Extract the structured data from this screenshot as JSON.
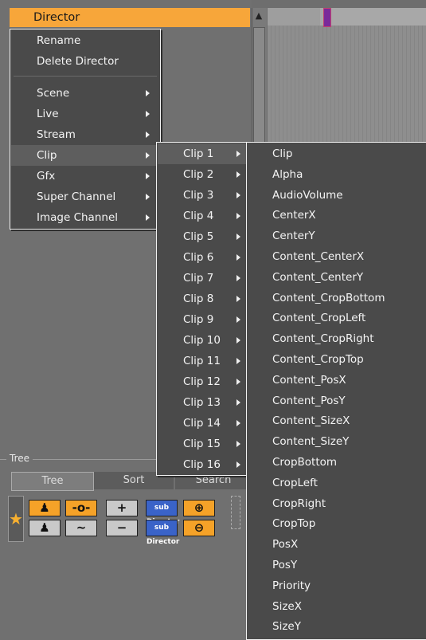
{
  "tree": {
    "root_item": "Director",
    "section_label": "Tree",
    "tabs": [
      "Tree",
      "Sort",
      "Search"
    ]
  },
  "context_menu": {
    "items": [
      {
        "label": "Rename",
        "submenu": false
      },
      {
        "label": "Delete Director",
        "submenu": false
      },
      {
        "label": "Scene",
        "submenu": true
      },
      {
        "label": "Live",
        "submenu": true
      },
      {
        "label": "Stream",
        "submenu": true
      },
      {
        "label": "Clip",
        "submenu": true,
        "selected": true
      },
      {
        "label": "Gfx",
        "submenu": true
      },
      {
        "label": "Super Channel",
        "submenu": true
      },
      {
        "label": "Image Channel",
        "submenu": true
      }
    ]
  },
  "clip_menu": {
    "items": [
      "Clip 1",
      "Clip 2",
      "Clip 3",
      "Clip 4",
      "Clip 5",
      "Clip 6",
      "Clip 7",
      "Clip 8",
      "Clip 9",
      "Clip 10",
      "Clip 11",
      "Clip 12",
      "Clip 13",
      "Clip 14",
      "Clip 15",
      "Clip 16"
    ],
    "selected_index": 0
  },
  "property_menu": {
    "items": [
      "Clip",
      "Alpha",
      "AudioVolume",
      "CenterX",
      "CenterY",
      "Content_CenterX",
      "Content_CenterY",
      "Content_CropBottom",
      "Content_CropLeft",
      "Content_CropRight",
      "Content_CropTop",
      "Content_PosX",
      "Content_PosY",
      "Content_SizeX",
      "Content_SizeY",
      "CropBottom",
      "CropLeft",
      "CropRight",
      "CropTop",
      "PosX",
      "PosY",
      "Priority",
      "SizeX",
      "SizeY"
    ]
  },
  "toolbar": {
    "buttons": [
      "person-icon",
      "link-icon",
      "plus-icon",
      "sub-director-icon",
      "zoom-in-icon",
      "person-icon",
      "curve-icon",
      "minus-icon",
      "sub-director-icon",
      "zoom-out-icon"
    ],
    "sub_director_label": "sub Director"
  },
  "colors": {
    "accent": "#f7a63a",
    "menu_bg": "#4a4a4a"
  }
}
